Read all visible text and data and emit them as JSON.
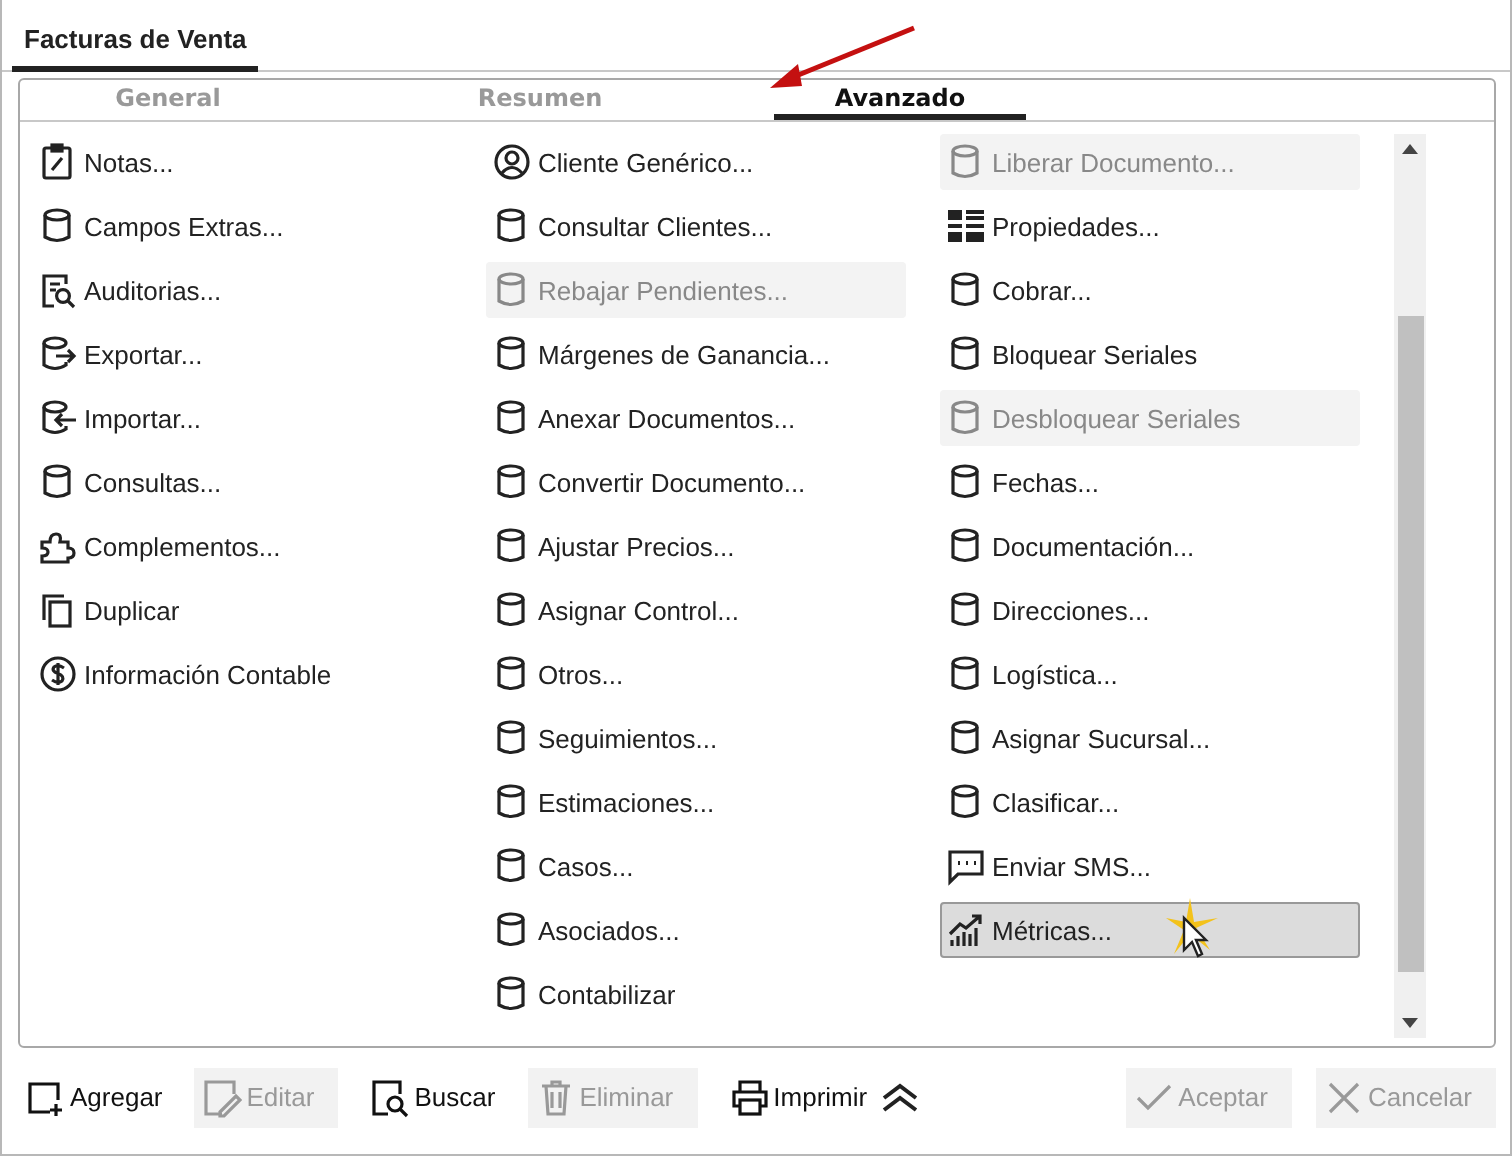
{
  "window": {
    "title": "Facturas de Venta"
  },
  "tabs": [
    {
      "label": "General",
      "selected": false
    },
    {
      "label": "Resumen",
      "selected": false
    },
    {
      "label": "Avanzado",
      "selected": true
    }
  ],
  "columns": [
    [
      {
        "label": "Notas...",
        "kind": "notes",
        "disabled": false,
        "selected": false
      },
      {
        "label": "Campos Extras...",
        "kind": "db",
        "disabled": false,
        "selected": false
      },
      {
        "label": "Auditorias...",
        "kind": "audit",
        "disabled": false,
        "selected": false
      },
      {
        "label": "Exportar...",
        "kind": "export",
        "disabled": false,
        "selected": false
      },
      {
        "label": "Importar...",
        "kind": "import",
        "disabled": false,
        "selected": false
      },
      {
        "label": "Consultas...",
        "kind": "db",
        "disabled": false,
        "selected": false
      },
      {
        "label": "Complementos...",
        "kind": "puzzle",
        "disabled": false,
        "selected": false
      },
      {
        "label": "Duplicar",
        "kind": "copy",
        "disabled": false,
        "selected": false
      },
      {
        "label": "Información Contable",
        "kind": "dollar",
        "disabled": false,
        "selected": false
      }
    ],
    [
      {
        "label": "Cliente Genérico...",
        "kind": "user",
        "disabled": false,
        "selected": false
      },
      {
        "label": "Consultar Clientes...",
        "kind": "db",
        "disabled": false,
        "selected": false
      },
      {
        "label": "Rebajar Pendientes...",
        "kind": "db",
        "disabled": true,
        "selected": false
      },
      {
        "label": "Márgenes de Ganancia...",
        "kind": "db",
        "disabled": false,
        "selected": false
      },
      {
        "label": "Anexar Documentos...",
        "kind": "db",
        "disabled": false,
        "selected": false
      },
      {
        "label": "Convertir Documento...",
        "kind": "db",
        "disabled": false,
        "selected": false
      },
      {
        "label": "Ajustar Precios...",
        "kind": "db",
        "disabled": false,
        "selected": false
      },
      {
        "label": "Asignar Control...",
        "kind": "db",
        "disabled": false,
        "selected": false
      },
      {
        "label": "Otros...",
        "kind": "db",
        "disabled": false,
        "selected": false
      },
      {
        "label": "Seguimientos...",
        "kind": "db",
        "disabled": false,
        "selected": false
      },
      {
        "label": "Estimaciones...",
        "kind": "db",
        "disabled": false,
        "selected": false
      },
      {
        "label": "Casos...",
        "kind": "db",
        "disabled": false,
        "selected": false
      },
      {
        "label": "Asociados...",
        "kind": "db",
        "disabled": false,
        "selected": false
      },
      {
        "label": "Contabilizar",
        "kind": "db",
        "disabled": false,
        "selected": false
      }
    ],
    [
      {
        "label": "Liberar Documento...",
        "kind": "db",
        "disabled": true,
        "selected": false
      },
      {
        "label": "Propiedades...",
        "kind": "grid",
        "disabled": false,
        "selected": false
      },
      {
        "label": "Cobrar...",
        "kind": "db",
        "disabled": false,
        "selected": false
      },
      {
        "label": "Bloquear Seriales",
        "kind": "db",
        "disabled": false,
        "selected": false
      },
      {
        "label": "Desbloquear Seriales",
        "kind": "db",
        "disabled": true,
        "selected": false
      },
      {
        "label": "Fechas...",
        "kind": "db",
        "disabled": false,
        "selected": false
      },
      {
        "label": "Documentación...",
        "kind": "db",
        "disabled": false,
        "selected": false
      },
      {
        "label": "Direcciones...",
        "kind": "db",
        "disabled": false,
        "selected": false
      },
      {
        "label": "Logística...",
        "kind": "db",
        "disabled": false,
        "selected": false
      },
      {
        "label": "Asignar Sucursal...",
        "kind": "db",
        "disabled": false,
        "selected": false
      },
      {
        "label": "Clasificar...",
        "kind": "db",
        "disabled": false,
        "selected": false
      },
      {
        "label": "Enviar SMS...",
        "kind": "sms",
        "disabled": false,
        "selected": false
      },
      {
        "label": "Métricas...",
        "kind": "chart",
        "disabled": false,
        "selected": true
      }
    ]
  ],
  "toolbar": [
    {
      "label": "Agregar",
      "kind": "add",
      "disabled": false
    },
    {
      "label": "Editar",
      "kind": "edit",
      "disabled": true
    },
    {
      "label": "Buscar",
      "kind": "search",
      "disabled": false
    },
    {
      "label": "Eliminar",
      "kind": "delete",
      "disabled": true
    },
    {
      "label": "Imprimir",
      "kind": "print",
      "disabled": false
    }
  ],
  "dialog_buttons": [
    {
      "label": "Aceptar",
      "kind": "accept",
      "disabled": true
    },
    {
      "label": "Cancelar",
      "kind": "cancel",
      "disabled": true
    }
  ]
}
